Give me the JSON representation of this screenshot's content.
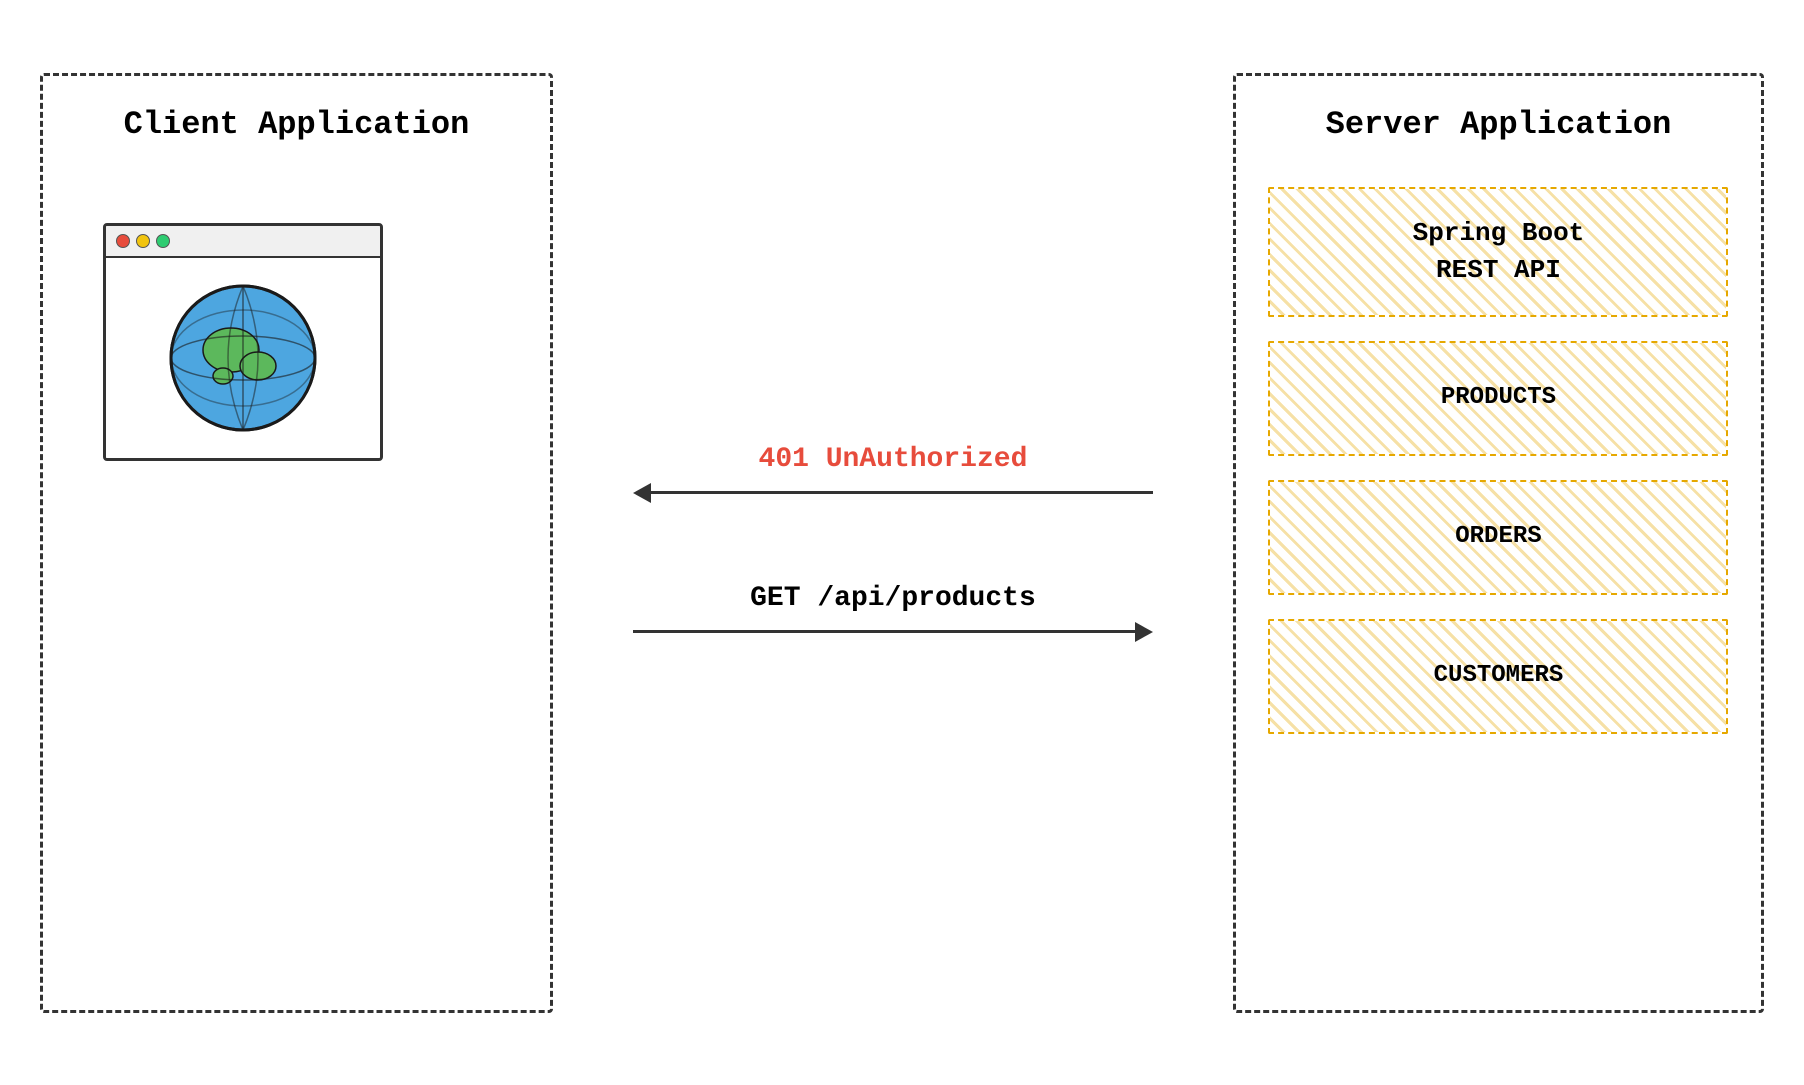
{
  "client": {
    "title": "Client Application"
  },
  "server": {
    "title": "Server Application",
    "spring_boot_label": "Spring Boot\nREST API",
    "spring_boot_line1": "Spring Boot",
    "spring_boot_line2": "REST API",
    "endpoints": [
      {
        "label": "PRODUCTS"
      },
      {
        "label": "ORDERS"
      },
      {
        "label": "CUSTOMERS"
      }
    ]
  },
  "arrows": {
    "response_label": "401 UnAuthorized",
    "request_label": "GET /api/products"
  },
  "browser_dots": [
    "red",
    "yellow",
    "green"
  ]
}
